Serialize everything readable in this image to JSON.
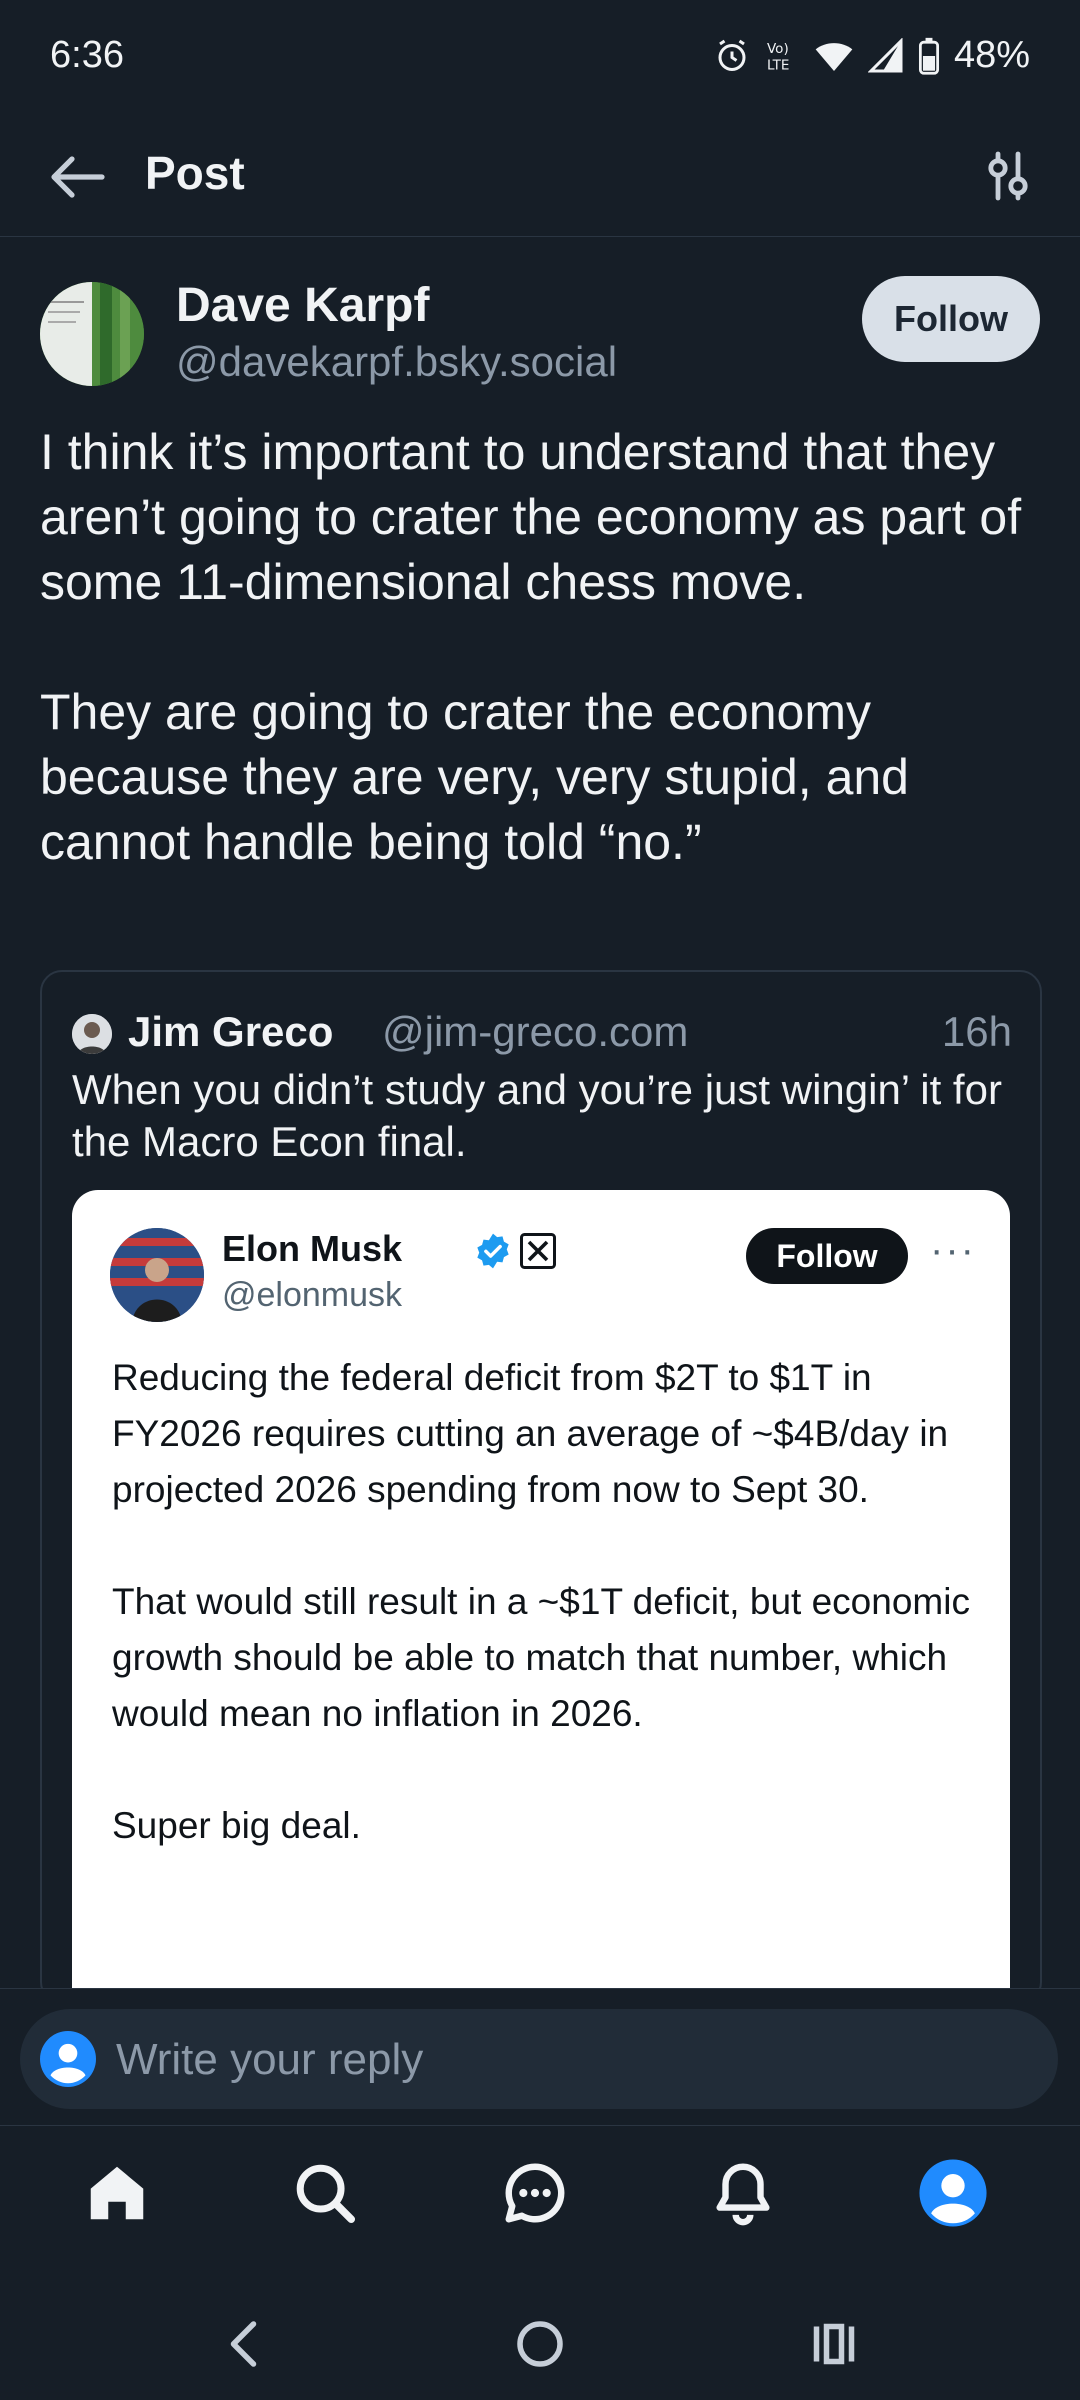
{
  "status_bar": {
    "time": "6:36",
    "battery": "48%"
  },
  "header": {
    "title": "Post"
  },
  "author": {
    "name": "Dave Karpf",
    "handle": "@davekarpf.bsky.social",
    "follow_label": "Follow"
  },
  "post": {
    "paragraphs": [
      "I think it’s important to understand that they aren’t going to crater the economy as part of some 11-dimensional chess move.",
      "They are going to crater the economy because they are very, very stupid, and cannot handle being told “no.”"
    ]
  },
  "quote": {
    "name": "Jim Greco",
    "handle": "@jim-greco.com",
    "time": "16h",
    "text": "When you didn’t study and you’re just wingin’ it for the Macro Econ final."
  },
  "embedded_tweet": {
    "name": "Elon Musk",
    "handle": "@elonmusk",
    "follow_label": "Follow",
    "more_label": "···",
    "paragraphs": [
      "Reducing the federal deficit from $2T to $1T in FY2026 requires cutting an average of ~$4B/day in projected 2026 spending from now to Sept 30.",
      "That would still result in a ~$1T deficit, but economic growth should be able to match that number, which would mean no inflation in 2026.",
      "Super big deal."
    ]
  },
  "reply": {
    "placeholder": "Write your reply"
  },
  "colors": {
    "background": "#161e27",
    "accent": "#208bfe",
    "muted": "#8c99a8"
  },
  "tabs": [
    "home-icon",
    "search-icon",
    "chat-icon",
    "bell-icon",
    "profile-icon"
  ]
}
